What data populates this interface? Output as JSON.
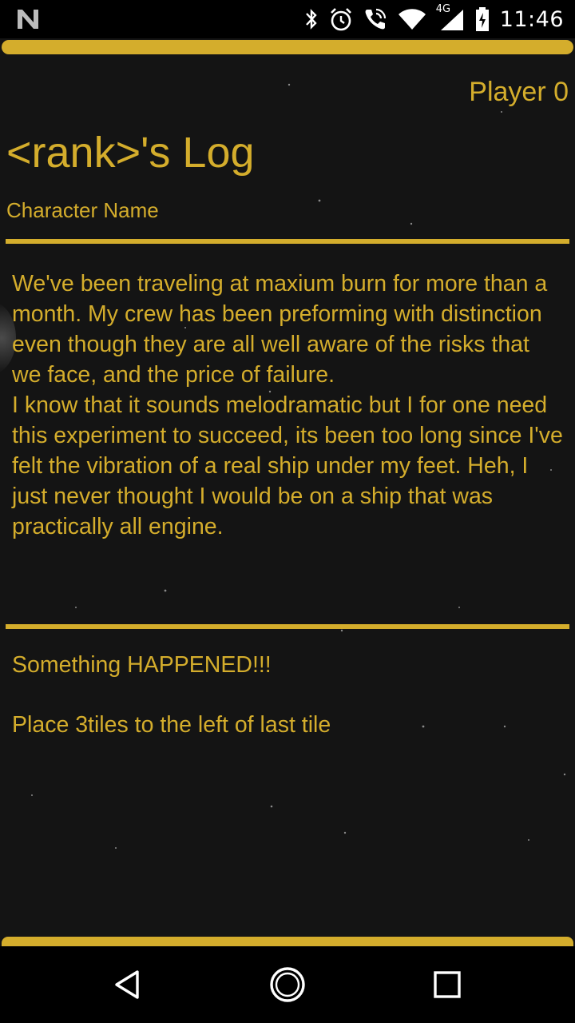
{
  "status_bar": {
    "time": "11:46",
    "network_type": "4G",
    "icons": [
      "n-logo-icon",
      "bluetooth-icon",
      "alarm-icon",
      "wifi-call-icon",
      "wifi-icon",
      "cell-signal-icon",
      "battery-charging-icon"
    ]
  },
  "header": {
    "player_label": "Player 0",
    "log_title": "<rank>'s Log",
    "character_name": "Character Name"
  },
  "log": {
    "paragraphs": [
      "We've been traveling at maxium burn for more than a month. My crew has been preforming with distinction even though they are all well aware of the risks that we face, and the price of failure.",
      "I know that it sounds melodramatic but I for one need this experiment to succeed, its been too long since I've felt the vibration of a real ship under my feet. Heh, I just never thought I would be on a ship that was practically all engine."
    ]
  },
  "event": {
    "title": "Something HAPPENED!!!",
    "instruction": "Place 3tiles to the left of last tile"
  },
  "nav_bar": {
    "icons": [
      "back-icon",
      "home-icon",
      "recents-icon"
    ]
  },
  "colors": {
    "accent": "#d4ad2c",
    "background": "#141414",
    "system_bar": "#000000"
  }
}
